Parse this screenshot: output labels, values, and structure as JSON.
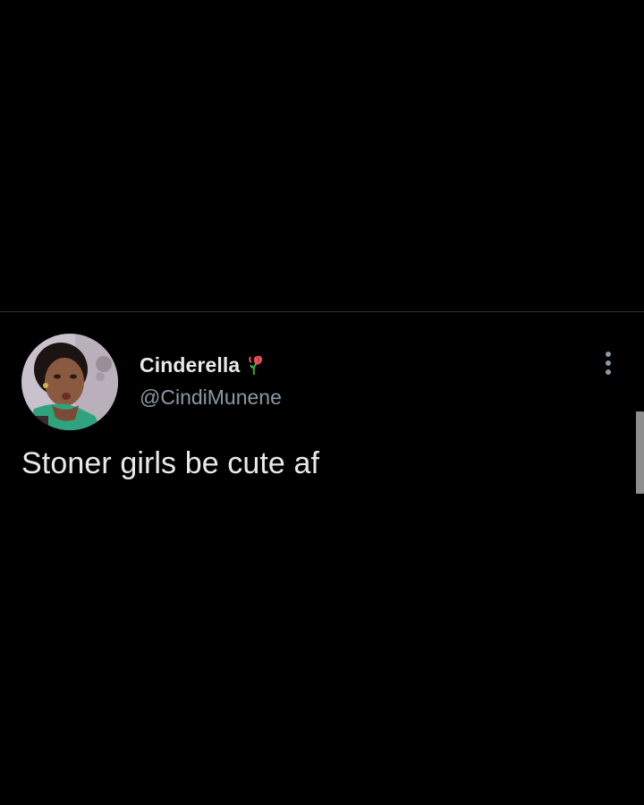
{
  "tweet": {
    "display_name": "Cinderella",
    "handle": "@CindiMunene",
    "text": "Stoner girls be cute af",
    "name_emoji": "wilted-rose-icon",
    "avatar": "profile-photo"
  },
  "menu": {
    "icon": "more-options-icon"
  },
  "colors": {
    "background": "#000000",
    "primary_text": "#e7e9ea",
    "secondary_text": "#8b98a5",
    "divider": "#2f3336"
  }
}
